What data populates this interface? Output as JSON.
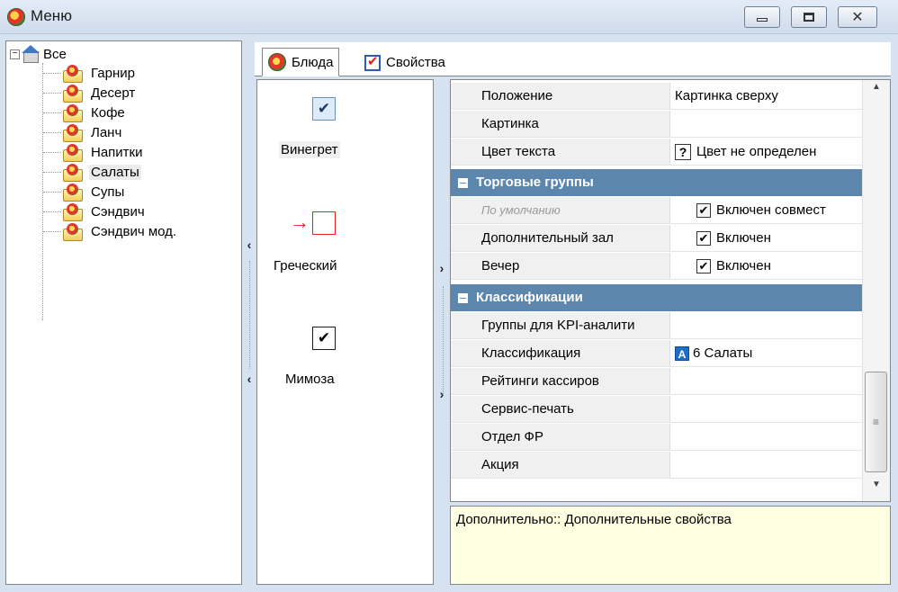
{
  "window": {
    "title": "Меню"
  },
  "tree": {
    "root_label": "Все",
    "items": [
      {
        "label": "Гарнир"
      },
      {
        "label": "Десерт"
      },
      {
        "label": "Кофе"
      },
      {
        "label": "Ланч"
      },
      {
        "label": "Напитки"
      },
      {
        "label": "Салаты",
        "selected": true
      },
      {
        "label": "Супы"
      },
      {
        "label": "Сэндвич"
      },
      {
        "label": "Сэндвич мод."
      }
    ]
  },
  "tabs": [
    {
      "label": "Блюда",
      "active": true
    },
    {
      "label": "Свойства",
      "active": false
    }
  ],
  "dishes": [
    {
      "label": "Винегрет",
      "state": "checked"
    },
    {
      "label": "Греческий",
      "state": "unchecked"
    },
    {
      "label": "Мимоза",
      "state": "checked"
    }
  ],
  "properties": {
    "rows_top": [
      {
        "name": "Положение",
        "value": "Картинка сверху"
      },
      {
        "name": "Картинка",
        "value": ""
      },
      {
        "name": "Цвет текста",
        "value": "Цвет не определен",
        "value_icon": "?"
      }
    ],
    "category_trade": "Торговые группы",
    "rows_trade": [
      {
        "name": "По умолчанию",
        "value": "Включен совмест",
        "disabled": true
      },
      {
        "name": "Дополнительный зал",
        "value": "Включен"
      },
      {
        "name": "Вечер",
        "value": "Включен"
      }
    ],
    "category_class": "Классификации",
    "rows_class": [
      {
        "name": "Группы для KPI-аналити",
        "value": ""
      },
      {
        "name": "Классификация",
        "value": "6 Салаты",
        "value_icon": "A"
      },
      {
        "name": "Рейтинги кассиров",
        "value": ""
      },
      {
        "name": "Сервис-печать",
        "value": ""
      },
      {
        "name": "Отдел ФР",
        "value": ""
      },
      {
        "name": "Акция",
        "value": ""
      }
    ]
  },
  "description": {
    "text": "Дополнительно:: Дополнительные свойства"
  },
  "colors": {
    "category_bg": "#5d86ad",
    "description_bg": "#ffffe1",
    "unchecked_marker": "#e02020"
  }
}
